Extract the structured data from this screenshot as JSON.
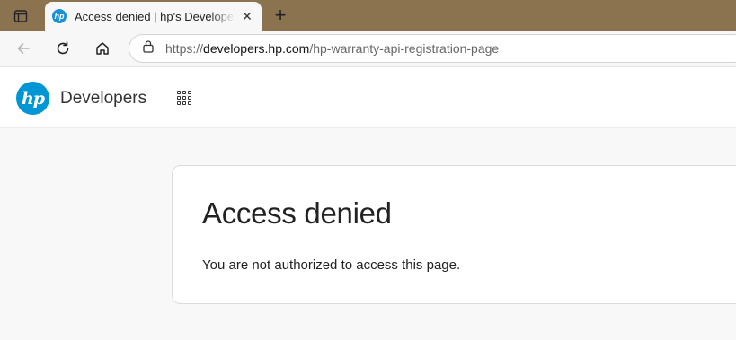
{
  "browser": {
    "tab": {
      "title": "Access denied | hp's Developer Portal",
      "favicon_text": "hp",
      "close_glyph": "✕"
    },
    "new_tab_glyph": "+",
    "url": {
      "scheme": "https://",
      "host": "developers.hp.com",
      "path": "/hp-warranty-api-registration-page"
    },
    "icons": [
      "tab-actions-icon",
      "back-arrow-icon",
      "refresh-icon",
      "home-icon",
      "lock-icon"
    ]
  },
  "site": {
    "logo_text": "hp",
    "brand": "Developers",
    "icons": [
      "apps-grid-icon"
    ]
  },
  "error": {
    "title": "Access denied",
    "message": "You are not authorized to access this page."
  },
  "colors": {
    "tabstrip": "#8c7350",
    "hp_blue": "#0096d6"
  }
}
